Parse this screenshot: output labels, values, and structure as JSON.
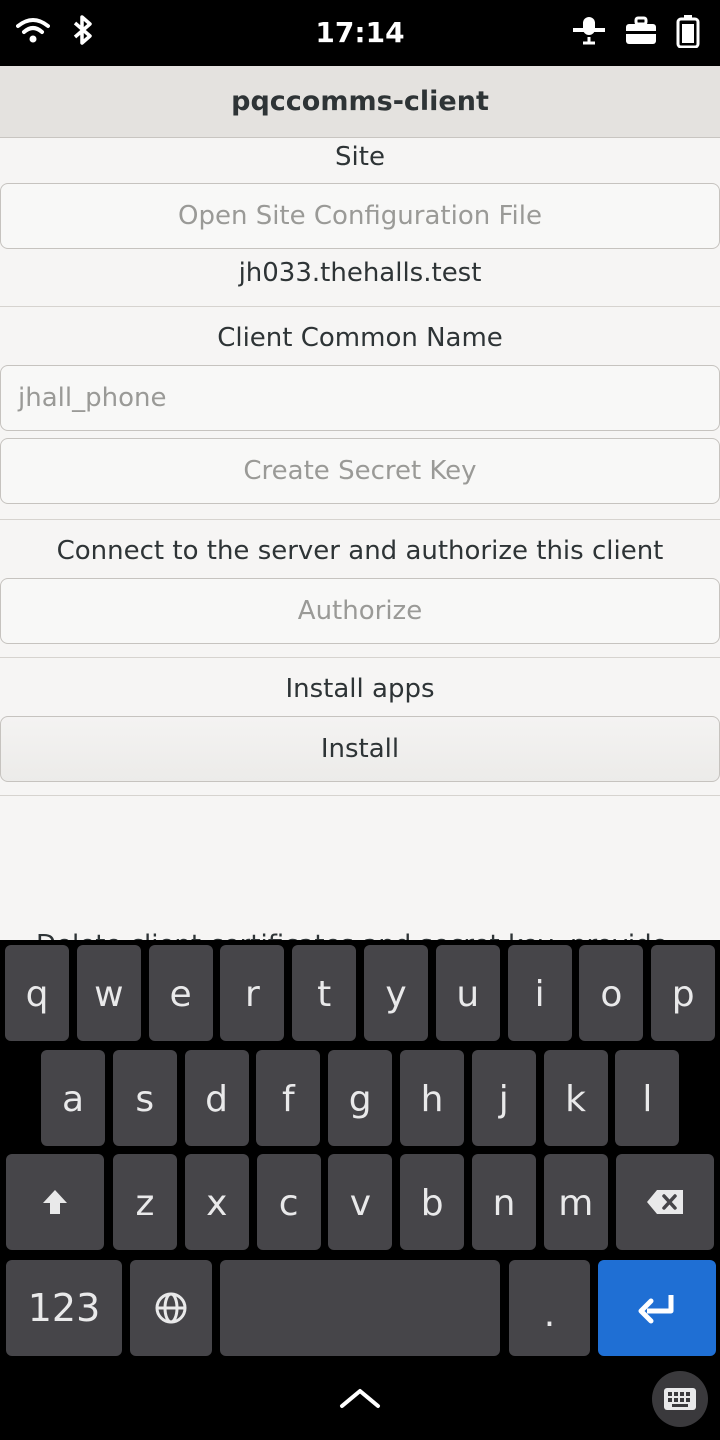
{
  "status": {
    "time": "17:14",
    "left_icons": [
      "wifi-icon",
      "bluetooth-icon"
    ],
    "right_icons": [
      "mic-off-icon",
      "briefcase-icon",
      "battery-icon"
    ]
  },
  "app": {
    "title": "pqccomms-client",
    "site_label": "Site",
    "open_site_button": "Open Site Configuration File",
    "site_value": "jh033.thehalls.test",
    "cn_label": "Client Common Name",
    "cn_placeholder": "jhall_phone",
    "create_key_button": "Create Secret Key",
    "authorize_label": "Connect to the server and authorize this client",
    "authorize_button": "Authorize",
    "install_label": "Install apps",
    "install_button": "Install",
    "obscured_text": "Delete client certificates and secret key, provide"
  },
  "keyboard": {
    "row1": [
      "q",
      "w",
      "e",
      "r",
      "t",
      "y",
      "u",
      "i",
      "o",
      "p"
    ],
    "row2": [
      "a",
      "s",
      "d",
      "f",
      "g",
      "h",
      "j",
      "k",
      "l"
    ],
    "row3": [
      "z",
      "x",
      "c",
      "v",
      "b",
      "n",
      "m"
    ],
    "numbers_key": "123",
    "period_key": "."
  },
  "colors": {
    "accent": "#1f6fd4",
    "key": "#464549",
    "background": "#f6f5f4"
  }
}
